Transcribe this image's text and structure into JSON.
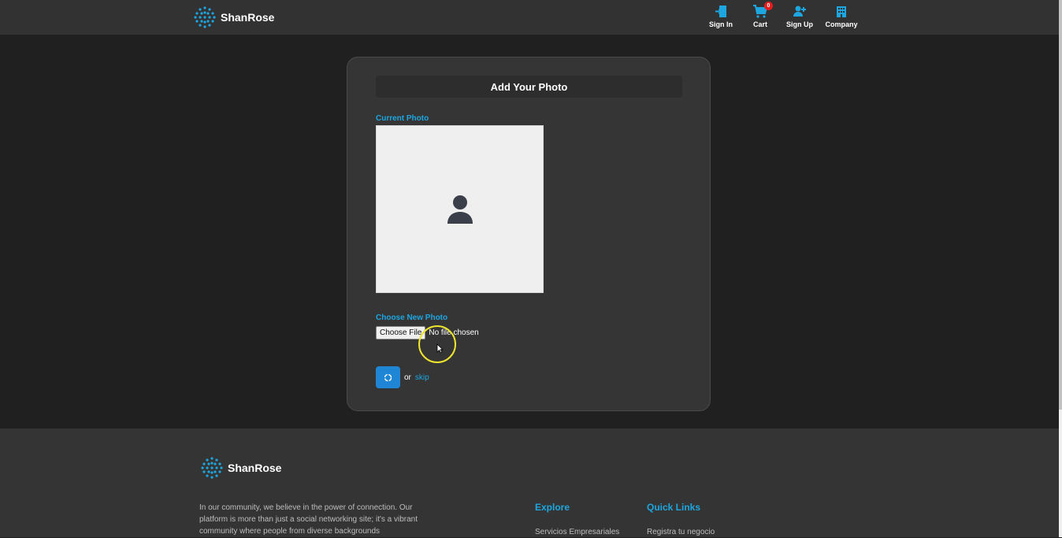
{
  "header": {
    "brand_name": "ShanRose",
    "nav": [
      {
        "label": "Sign In",
        "icon": "sign-in-icon"
      },
      {
        "label": "Cart",
        "icon": "cart-icon",
        "badge": "0"
      },
      {
        "label": "Sign Up",
        "icon": "user-plus-icon"
      },
      {
        "label": "Company",
        "icon": "building-icon"
      }
    ]
  },
  "card": {
    "title": "Add Your Photo",
    "current_photo_label": "Current Photo",
    "choose_new_photo_label": "Choose New Photo",
    "choose_file_button": "Choose File",
    "file_status": "No file chosen",
    "or_text": "or",
    "skip_link": "skip"
  },
  "footer": {
    "brand_name": "ShanRose",
    "about_text": "In our community, we believe in the power of connection. Our platform is more than just a social networking site; it's a vibrant community where people from diverse backgrounds",
    "explore": {
      "heading": "Explore",
      "link": "Servicios Empresariales"
    },
    "quick_links": {
      "heading": "Quick Links",
      "link": "Registra tu negocio"
    }
  },
  "colors": {
    "accent": "#1ea6e0",
    "primary_button": "#1f86d6",
    "badge": "#e51d1d",
    "header_bg": "#323232",
    "page_bg": "#202020",
    "card_bg": "#353535"
  }
}
